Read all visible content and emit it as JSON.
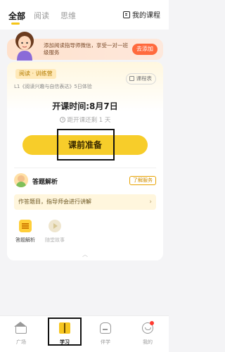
{
  "top_tabs": [
    {
      "label": "全部",
      "active": true
    },
    {
      "label": "阅读",
      "active": false
    },
    {
      "label": "思维",
      "active": false
    }
  ],
  "my_courses_label": "我的课程",
  "banner": {
    "text": "添加阅读指导师微信，享受一对一班级服务",
    "button": "去添加"
  },
  "course": {
    "tag": "阅读 · 训练营",
    "schedule_label": "课程表",
    "subtitle": "L1《阅读兴趣与自信表达》5日体验",
    "start_time": "开课时间:8月7日",
    "countdown": "距开课还剩 1 天",
    "prep_button": "课前准备"
  },
  "teacher": {
    "name": "答题解析",
    "service_tag": "了解服务"
  },
  "notice": {
    "text": "作答题目，指导师会进行讲解",
    "arrow": "›"
  },
  "features": [
    {
      "label": "答题解析",
      "icon": "answer-doc-icon",
      "enabled": true
    },
    {
      "label": "随堂故事",
      "icon": "story-play-icon",
      "enabled": false
    }
  ],
  "collapse_glyph": "︿",
  "bottom_nav": [
    {
      "label": "广场",
      "icon": "home-icon",
      "active": false
    },
    {
      "label": "学习",
      "icon": "book-icon",
      "active": true
    },
    {
      "label": "伴学",
      "icon": "companion-icon",
      "active": false
    },
    {
      "label": "我的",
      "icon": "profile-icon",
      "active": false
    }
  ],
  "colors": {
    "accent": "#f7cd2a",
    "add_button": "#ff6a3d",
    "badge": "#ff3b30"
  }
}
